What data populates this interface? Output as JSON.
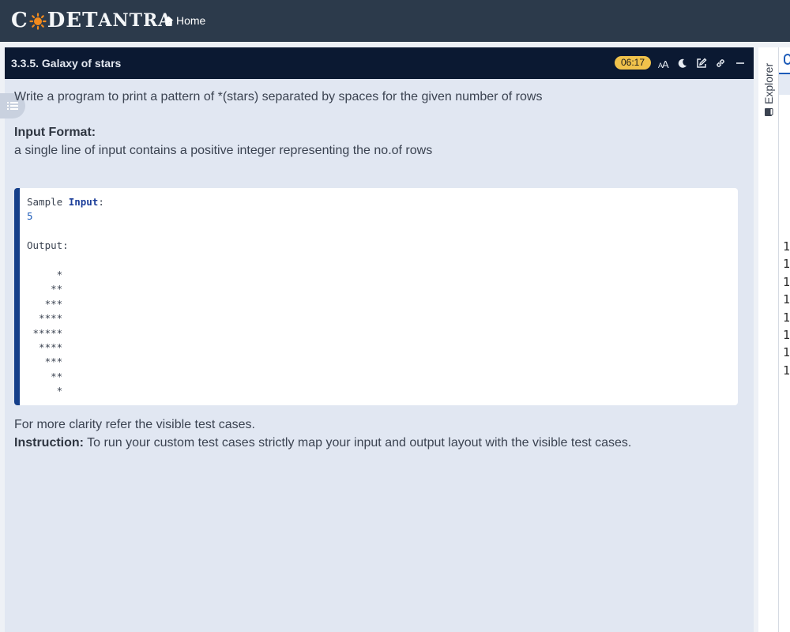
{
  "topbar": {
    "logo_text_1": "C",
    "logo_text_2": "DET",
    "logo_text_3": "ANTRA",
    "home_label": "Home"
  },
  "panel": {
    "title": "3.3.5. Galaxy of stars",
    "timer": "06:17"
  },
  "problem": {
    "description": "Write a program to print a pattern of *(stars) separated by spaces for the given number of rows",
    "input_format_heading": "Input Format:",
    "input_format_text": "a single line of input contains a positive integer representing the no.of rows",
    "sample": {
      "label_prefix": "Sample ",
      "label_keyword": "Input",
      "label_suffix": ":",
      "input_value": "5",
      "output_label": "Output:",
      "output_lines": [
        "     *",
        "    **",
        "   ***",
        "  ****",
        " *****",
        "  ****",
        "   ***",
        "    **",
        "     *"
      ]
    },
    "clarity_text": "For more clarity refer the visible test cases.",
    "instruction_label": "Instruction:",
    "instruction_text": " To run your custom test cases strictly map your input and output layout with the visible test cases."
  },
  "explorer": {
    "label": "Explorer"
  },
  "editor": {
    "gutter_lines": [
      "1",
      "1",
      "1",
      "1",
      "1",
      "1",
      "1",
      "1"
    ]
  },
  "icons": {
    "home": "home-icon",
    "font_size": "font-size-icon",
    "theme": "moon-icon",
    "edit": "edit-icon",
    "link": "link-icon",
    "minimize": "minus-icon",
    "toc": "list-icon",
    "explorer": "book-icon"
  },
  "colors": {
    "topbar": "#2c3a4b",
    "panel_header": "#0b1932",
    "timer_badge": "#f0c24b",
    "code_accent": "#153f8a",
    "panel_bg": "#e1e7f2"
  }
}
